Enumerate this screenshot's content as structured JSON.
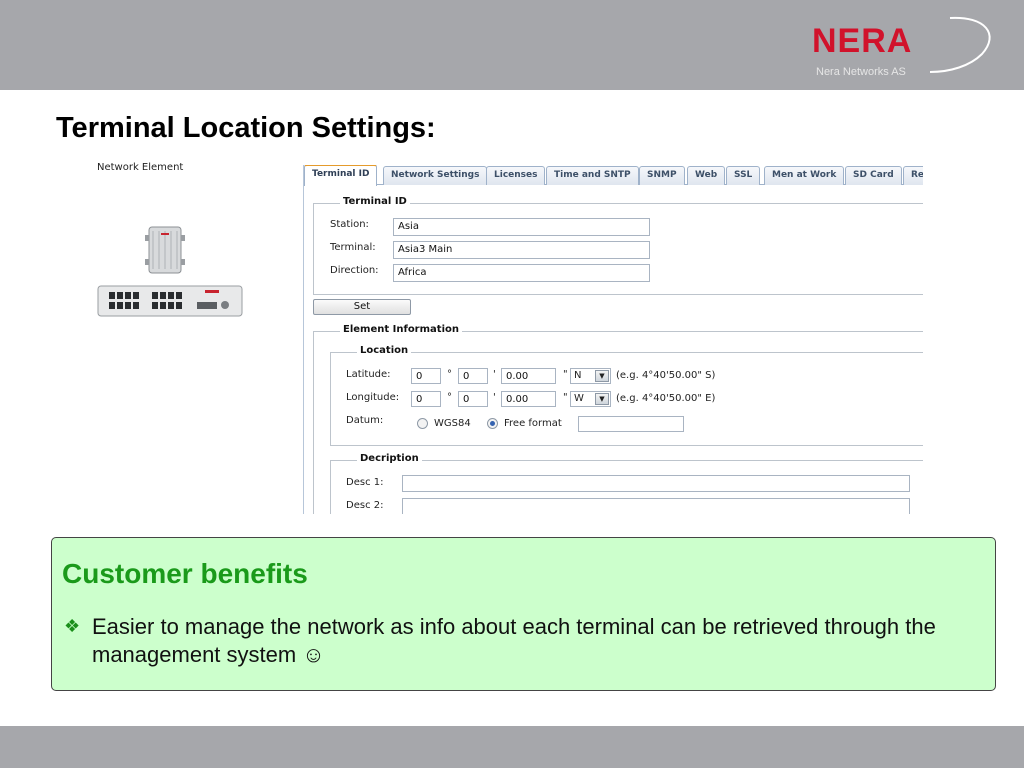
{
  "header": {
    "logo_text": "NERA",
    "logo_subtitle": "Nera Networks AS",
    "brand_color": "#d1122b",
    "band_color": "#a6a7ab"
  },
  "slide": {
    "title": "Terminal Location Settings:"
  },
  "network_element": {
    "label": "Network Element"
  },
  "web_ui": {
    "tabs": [
      "Terminal ID",
      "Network Settings",
      "Licenses",
      "Time and SNTP",
      "SNMP",
      "Web",
      "SSL",
      "Men at Work",
      "SD Card",
      "Re"
    ],
    "active_tab": "Terminal ID",
    "active_tab_accent": "#e59b2c",
    "terminal_id": {
      "legend": "Terminal ID",
      "station_label": "Station:",
      "station_value": "Asia",
      "terminal_label": "Terminal:",
      "terminal_value": "Asia3 Main",
      "direction_label": "Direction:",
      "direction_value": "Africa"
    },
    "set_button": "Set",
    "element_information": {
      "legend": "Element Information",
      "location": {
        "legend": "Location",
        "latitude_label": "Latitude:",
        "lat_deg": "0",
        "lat_min": "0",
        "lat_sec": "0.00",
        "lat_hemi": "N",
        "lat_example": "(e.g. 4°40'50.00\" S)",
        "longitude_label": "Longitude:",
        "lon_deg": "0",
        "lon_min": "0",
        "lon_sec": "0.00",
        "lon_hemi": "W",
        "lon_example": "(e.g. 4°40'50.00\" E)",
        "deg_symbol": "°",
        "min_symbol": "'",
        "sec_symbol": "\"",
        "datum_label": "Datum:",
        "datum_option_1": "WGS84",
        "datum_option_2": "Free format",
        "datum_selected": "Free format",
        "free_format_value": ""
      },
      "description": {
        "legend": "Decription",
        "desc1_label": "Desc 1:",
        "desc1_value": "",
        "desc2_label": "Desc 2:",
        "desc2_value": ""
      }
    }
  },
  "benefits": {
    "title": "Customer benefits",
    "bullet_glyph": "❖",
    "text": "Easier to manage the network as info about each terminal can be retrieved through the management system ☺",
    "box_color": "#ccffcc",
    "title_color": "#1a9a1a"
  }
}
